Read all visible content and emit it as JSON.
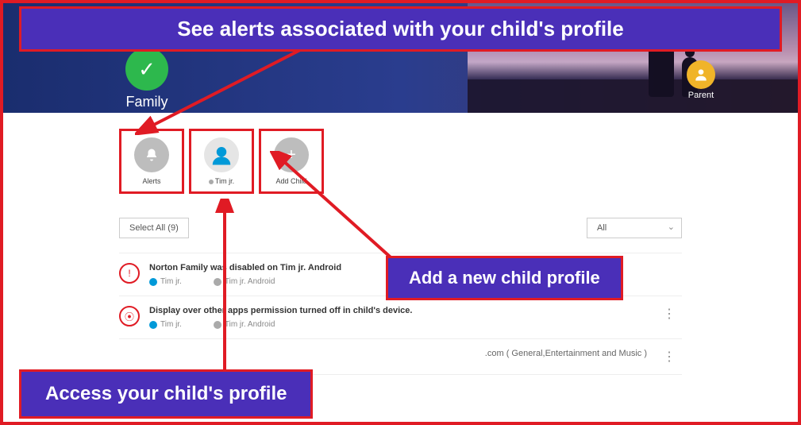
{
  "header": {
    "family_label": "Family",
    "parent_label": "Parent"
  },
  "cards": {
    "alerts_label": "Alerts",
    "child_label": "Tim jr.",
    "add_label": "Add Child"
  },
  "toolbar": {
    "select_all": "Select All (9)",
    "filter_value": "All"
  },
  "alerts": [
    {
      "icon": "!",
      "title": "Norton Family was disabled on Tim jr. Android",
      "child": "Tim jr.",
      "device": "Tim jr. Android"
    },
    {
      "icon": "⦿",
      "title": "Display over other apps permission turned off in child's device.",
      "child": "Tim jr.",
      "device": "Tim jr. Android"
    },
    {
      "icon": "",
      "title": ".com ( General,Entertainment and Music )",
      "child": "",
      "device": ""
    }
  ],
  "annotations": {
    "top": "See alerts associated with your child's profile",
    "mid": "Add a new child profile",
    "bot": "Access your child's profile"
  }
}
